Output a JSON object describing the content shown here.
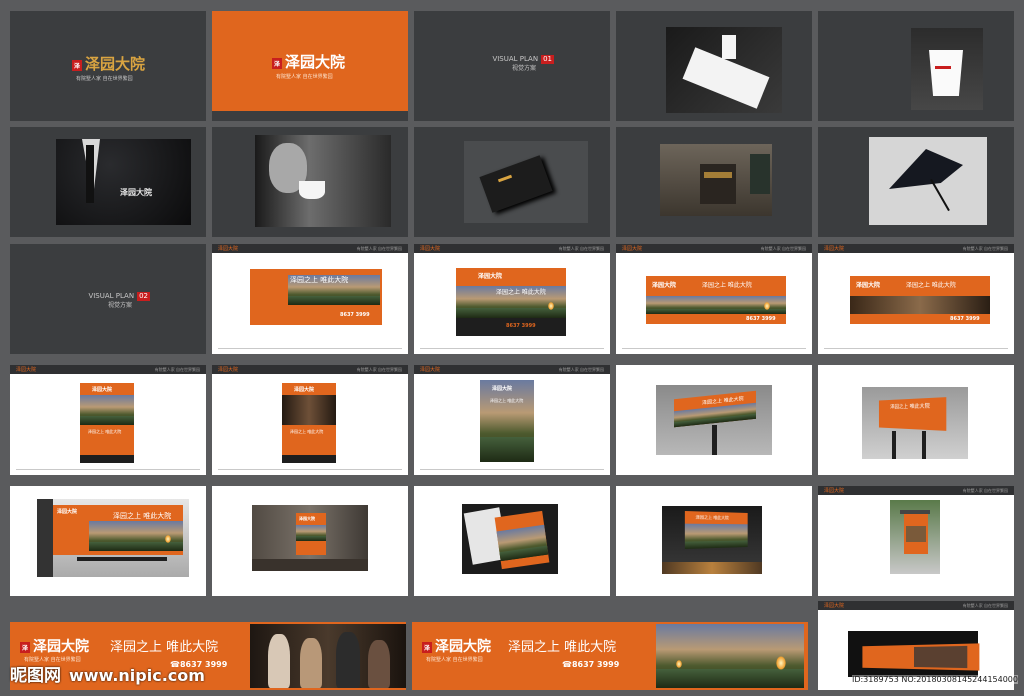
{
  "brand": {
    "logo_text": "泽园大院",
    "seal_text": "泽",
    "slogan": "有院墅人家  自在世界繁园",
    "headline": "泽园之上  唯此大院",
    "phone": "8637 3999",
    "phone_prefix": "☎"
  },
  "visual_plan": [
    {
      "label": "VISUAL PLAN",
      "sub": "视觉方案",
      "num": "01"
    },
    {
      "label": "VISUAL PLAN",
      "sub": "视觉方案",
      "num": "02"
    }
  ],
  "watermark": {
    "site_name": "昵图网",
    "site_url": "www.nipic.com",
    "id_text": "ID:3189753 NO:20180308145244154000"
  },
  "colors": {
    "background": "#5a5b5d",
    "dark_slide": "#3b3d3f",
    "orange": "#e0661e",
    "gold": "#d9a441",
    "seal_red": "#c81e1e"
  }
}
